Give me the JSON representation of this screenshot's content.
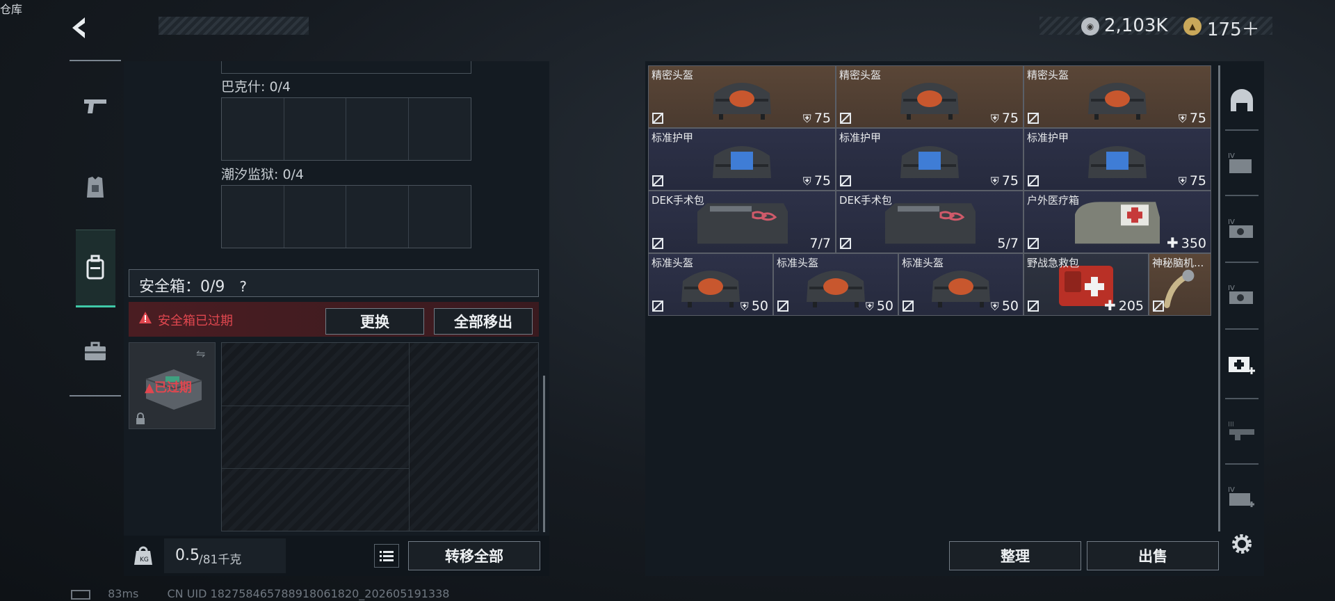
{
  "header": {
    "title": "仓库",
    "currency1": "2,103K",
    "currency2": "175＋"
  },
  "left_nav": [
    {
      "name": "weapons-nav",
      "icon": "pistol-icon"
    },
    {
      "name": "equipment-nav",
      "icon": "vest-icon"
    },
    {
      "name": "backpack-nav",
      "icon": "backpack-icon"
    },
    {
      "name": "case-nav",
      "icon": "briefcase-icon"
    }
  ],
  "left_panel": {
    "slot1_label": "巴克什: 0/4",
    "slot2_label": "潮汐监狱: 0/4",
    "safe_label": "安全箱：0/9",
    "safe_help": "?",
    "expired_msg": "安全箱已过期",
    "replace_btn": "更换",
    "remove_all_btn": "全部移出",
    "safe_item_status": "已过期",
    "weight_value": "0.5",
    "weight_max": "/81千克",
    "transfer_all_btn": "转移全部"
  },
  "items": [
    {
      "name": "精密头盔",
      "value": "75",
      "type": "armor",
      "bg": "brown",
      "art": "helmet"
    },
    {
      "name": "精密头盔",
      "value": "75",
      "type": "armor",
      "bg": "brown",
      "art": "helmet"
    },
    {
      "name": "精密头盔",
      "value": "75",
      "type": "armor",
      "bg": "brown",
      "art": "helmet"
    },
    {
      "name": "标准护甲",
      "value": "75",
      "type": "armor",
      "bg": "navy",
      "art": "vest"
    },
    {
      "name": "标准护甲",
      "value": "75",
      "type": "armor",
      "bg": "navy",
      "art": "vest"
    },
    {
      "name": "标准护甲",
      "value": "75",
      "type": "armor",
      "bg": "navy",
      "art": "vest"
    },
    {
      "name": "DEK手术包",
      "value": "7/7",
      "type": "count",
      "bg": "navy",
      "art": "kit"
    },
    {
      "name": "DEK手术包",
      "value": "5/7",
      "type": "count",
      "bg": "navy",
      "art": "kit"
    },
    {
      "name": "户外医疗箱",
      "value": "350",
      "type": "heal",
      "bg": "navy",
      "art": "medbag"
    },
    {
      "name": "标准头盔",
      "value": "50",
      "type": "armor",
      "bg": "navy",
      "art": "helmet"
    },
    {
      "name": "标准头盔",
      "value": "50",
      "type": "armor",
      "bg": "navy",
      "art": "helmet"
    },
    {
      "name": "标准头盔",
      "value": "50",
      "type": "armor",
      "bg": "navy",
      "art": "helmet"
    },
    {
      "name": "野战急救包",
      "value": "205",
      "type": "heal",
      "bg": "grey",
      "art": "redkit"
    },
    {
      "name": "神秘脑机...",
      "value": "",
      "type": "none",
      "bg": "brown",
      "art": "device"
    }
  ],
  "right_panel": {
    "sort_btn": "整理",
    "sell_btn": "出售"
  },
  "footer": {
    "ping": "83ms",
    "uid": "CN UID 18275846578891806182​0_202605191338"
  },
  "colors": {
    "accent": "#3fc9a8",
    "warning": "#e0474f",
    "brown": "#5a4637",
    "navy": "#2d3148"
  }
}
